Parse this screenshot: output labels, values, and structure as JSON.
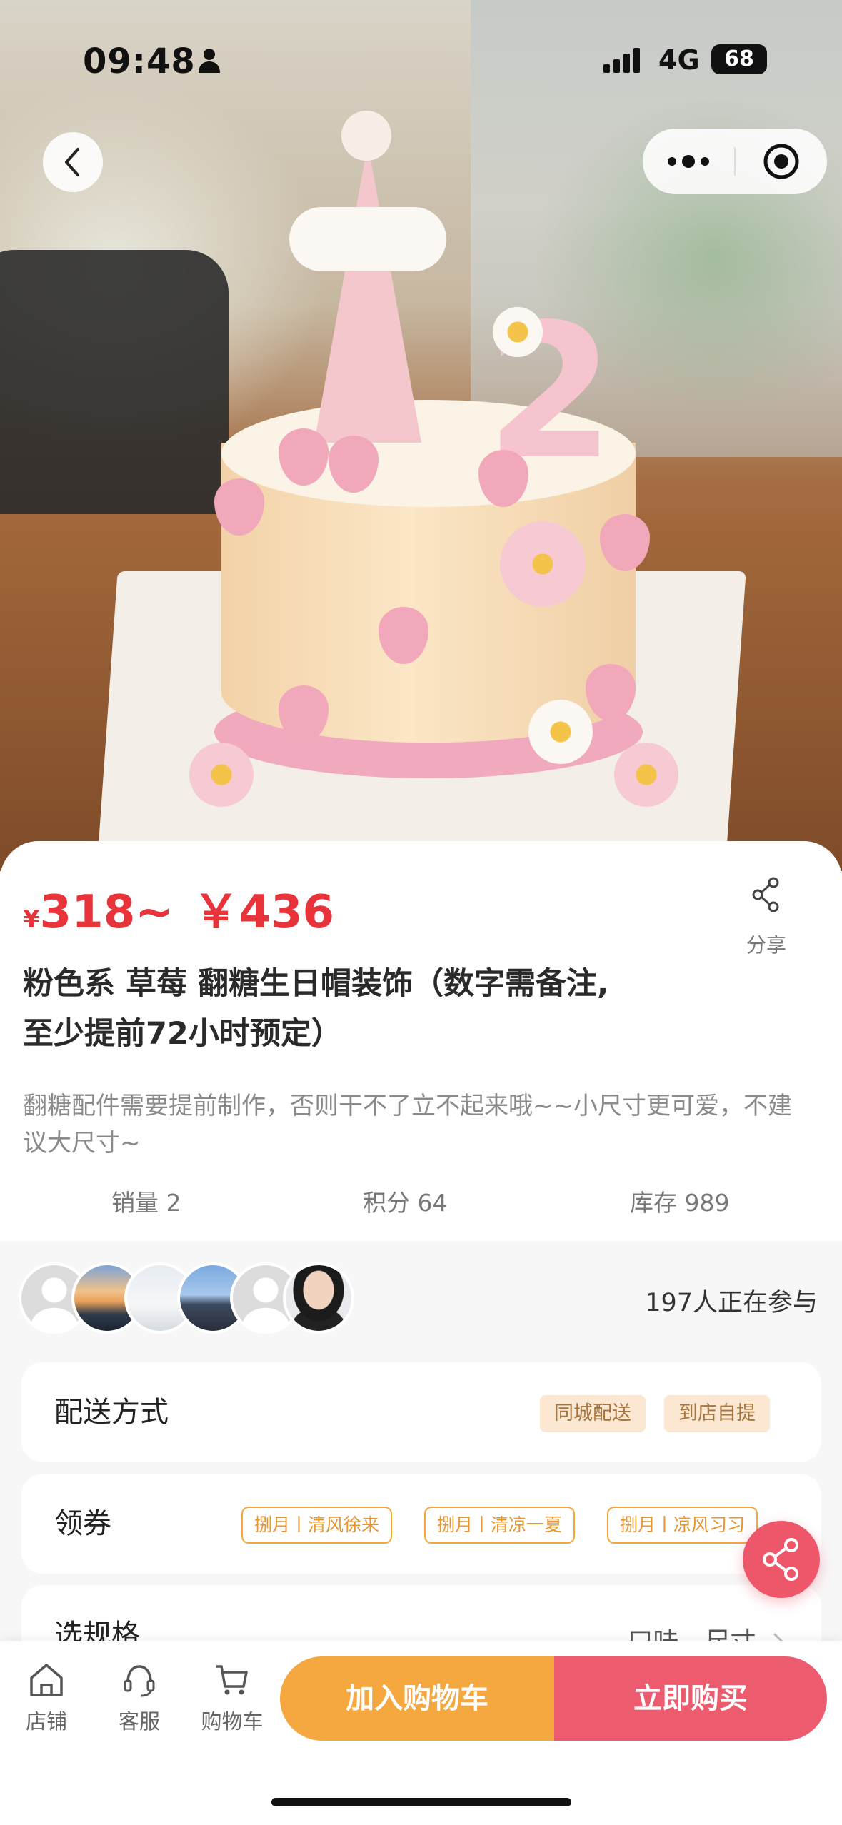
{
  "status_bar": {
    "time": "09:48",
    "network": "4G",
    "battery": "68"
  },
  "product": {
    "price_currency": "¥",
    "price_low": "318~",
    "price_high": "￥436",
    "title_line1": "粉色系 草莓 翻糖生日帽装饰（数字需备注,",
    "title_line2": "至少提前72小时预定）",
    "description": "翻糖配件需要提前制作，否则干不了立不起来哦~~小尺寸更可爱，不建议大尺寸~",
    "share_label": "分享"
  },
  "stats": {
    "sales": "销量 2",
    "points": "积分 64",
    "stock": "库存 989"
  },
  "participants": {
    "count_text": "197人正在参与"
  },
  "delivery": {
    "label": "配送方式",
    "options": [
      "同城配送",
      "到店自提"
    ]
  },
  "coupons": {
    "label": "领券",
    "items": [
      "捌月丨清风徐来",
      "捌月丨清凉一夏",
      "捌月丨凉风习习"
    ]
  },
  "spec": {
    "label": "选规格",
    "value": "口味、尺寸"
  },
  "bottom_bar": {
    "tabs": [
      {
        "label": "店铺",
        "icon": "store-icon"
      },
      {
        "label": "客服",
        "icon": "customer-service-icon"
      },
      {
        "label": "购物车",
        "icon": "cart-icon"
      }
    ],
    "add_to_cart": "加入购物车",
    "buy_now": "立即购买"
  },
  "colors": {
    "price_red": "#e8333b",
    "cart_orange": "#f4a83f",
    "buy_pink": "#ec5b6e",
    "tag_bg": "#fbe7d2"
  }
}
